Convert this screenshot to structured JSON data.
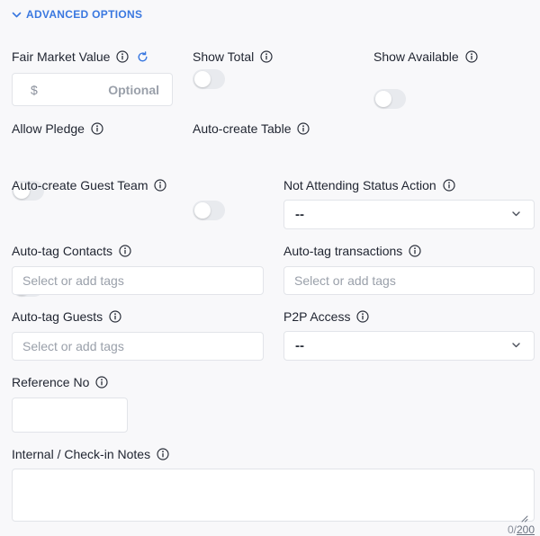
{
  "section": {
    "title": "ADVANCED OPTIONS",
    "accent": "#3a78e0",
    "icon": "chevron-down-icon"
  },
  "fair_market_value": {
    "label": "Fair Market Value",
    "currency": "$",
    "placeholder": "Optional",
    "value": ""
  },
  "show_total": {
    "label": "Show Total",
    "on": false
  },
  "show_available": {
    "label": "Show Available",
    "on": false
  },
  "allow_pledge": {
    "label": "Allow Pledge",
    "on": false
  },
  "auto_create_table": {
    "label": "Auto-create Table",
    "on": false
  },
  "auto_create_guest_team": {
    "label": "Auto-create Guest Team",
    "on": false
  },
  "not_attending_status_action": {
    "label": "Not Attending Status Action",
    "value": "--"
  },
  "auto_tag_contacts": {
    "label": "Auto-tag Contacts",
    "placeholder": "Select or add tags"
  },
  "auto_tag_transactions": {
    "label": "Auto-tag transactions",
    "placeholder": "Select or add tags"
  },
  "auto_tag_guests": {
    "label": "Auto-tag Guests",
    "placeholder": "Select or add tags"
  },
  "p2p_access": {
    "label": "P2P Access",
    "value": "--"
  },
  "reference_no": {
    "label": "Reference No",
    "value": ""
  },
  "internal_notes": {
    "label": "Internal / Check-in Notes",
    "value": "",
    "count": "0",
    "separator": "/",
    "max": "200"
  }
}
